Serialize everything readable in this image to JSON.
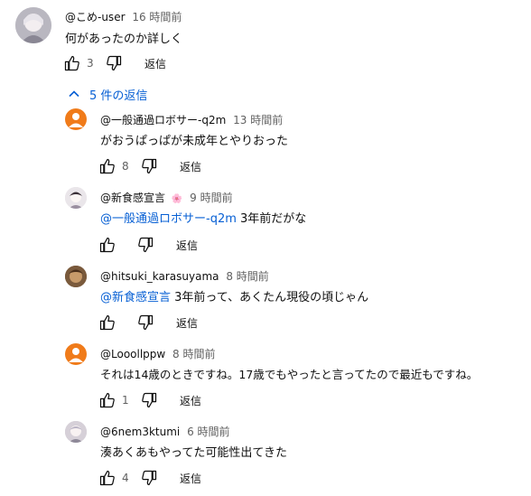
{
  "top_comment": {
    "author": "@こめ-user",
    "time": "16 時間前",
    "text": "何があったのか詳しく",
    "likes": "3",
    "reply_label": "返信"
  },
  "replies_toggle": {
    "label": "5 件の返信"
  },
  "replies": [
    {
      "author": "@一般通過ロボサー-q2m",
      "time": "13 時間前",
      "mention": "",
      "text": "がおうぱっぱが未成年とやりおった",
      "likes": "8",
      "reply_label": "返信",
      "avatar_color": "#f07b1a"
    },
    {
      "author": "@新食感宣言",
      "time": "9 時間前",
      "badge": "🌸",
      "mention": "@一般通過ロボサー-q2m",
      "text": " 3年前だがな",
      "likes": "",
      "reply_label": "返信",
      "avatar_color": "#d8d4d8"
    },
    {
      "author": "@hitsuki_karasuyama",
      "time": "8 時間前",
      "mention": "@新食感宣言",
      "text": " 3年前って、あくたん現役の頃じゃん",
      "likes": "",
      "reply_label": "返信",
      "avatar_color": "#6b4a2e"
    },
    {
      "author": "@Looollppw",
      "time": "8 時間前",
      "mention": "",
      "text": "それは14歳のときですね。17歳でもやったと言ってたので最近もですね。",
      "likes": "1",
      "reply_label": "返信",
      "avatar_color": "#f07b1a"
    },
    {
      "author": "@6nem3ktumi",
      "time": "6 時間前",
      "mention": "",
      "text": "湊あくあもやってた可能性出てきた",
      "likes": "4",
      "reply_label": "返信",
      "avatar_color": "#c9c4cc"
    }
  ]
}
